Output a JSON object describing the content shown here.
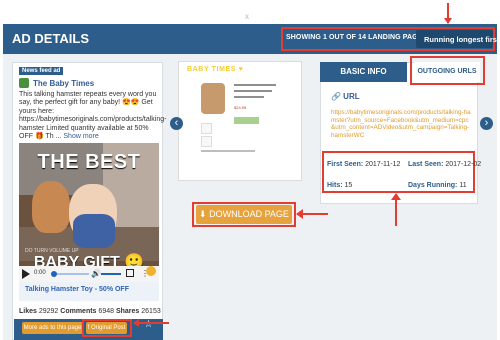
{
  "top_tick": "x",
  "header": {
    "title": "AD DETAILS",
    "landing_pages": "SHOWING 1 OUT OF 14 LANDING PAGES:",
    "sort_select": "Running longest first"
  },
  "ad": {
    "badge": "News feed ad",
    "page_name": "The Baby Times",
    "body": "This talking hamster repeats every word you say, the perfect gift for any baby! 😍😍 Get yours here: https://babytimesoriginals.com/products/talking-hamster Limited quantity available at 50% OFF 🎁 Th ...",
    "show_more": "Show more",
    "video_title": "THE BEST",
    "video_caption": "BABY GIFT 🙂",
    "video_watermark": "DO TURN VOLUME UP",
    "player_time": "0:00",
    "product_link": "Talking Hamster Toy - 50% OFF",
    "stats": {
      "likes_label": "Likes",
      "likes": "29292",
      "comments_label": "Comments",
      "comments": "6948",
      "shares_label": "Shares",
      "shares": "26153"
    },
    "buttons": {
      "more_ads": "More ads to this page",
      "original_post": "f Original Post"
    }
  },
  "preview": {
    "brand": "BABY TIMES ♥",
    "price": "$24.95"
  },
  "download": "⬇ DOWNLOAD PAGE",
  "panel": {
    "tab_basic": "BASIC INFO",
    "tab_outgoing": "OUTGOING URLS",
    "url_title": "🔗 URL",
    "url": "https://babytimesoriginals.com/products/talking-hamster?utm_source=Facebook&utm_medium=cpc&utm_content=ADVideo&utm_campaign=Talking-hamsterWC",
    "first_seen_label": "First Seen:",
    "first_seen": "2017-11-12",
    "last_seen_label": "Last Seen:",
    "last_seen": "2017-12-02",
    "hits_label": "Hits:",
    "hits": "15",
    "days_label": "Days Running:",
    "days": "11"
  },
  "icons": {
    "prev": "‹",
    "next": "›",
    "star": "☆",
    "play": "play-icon",
    "volume": "🔊",
    "menu": "⋮"
  }
}
